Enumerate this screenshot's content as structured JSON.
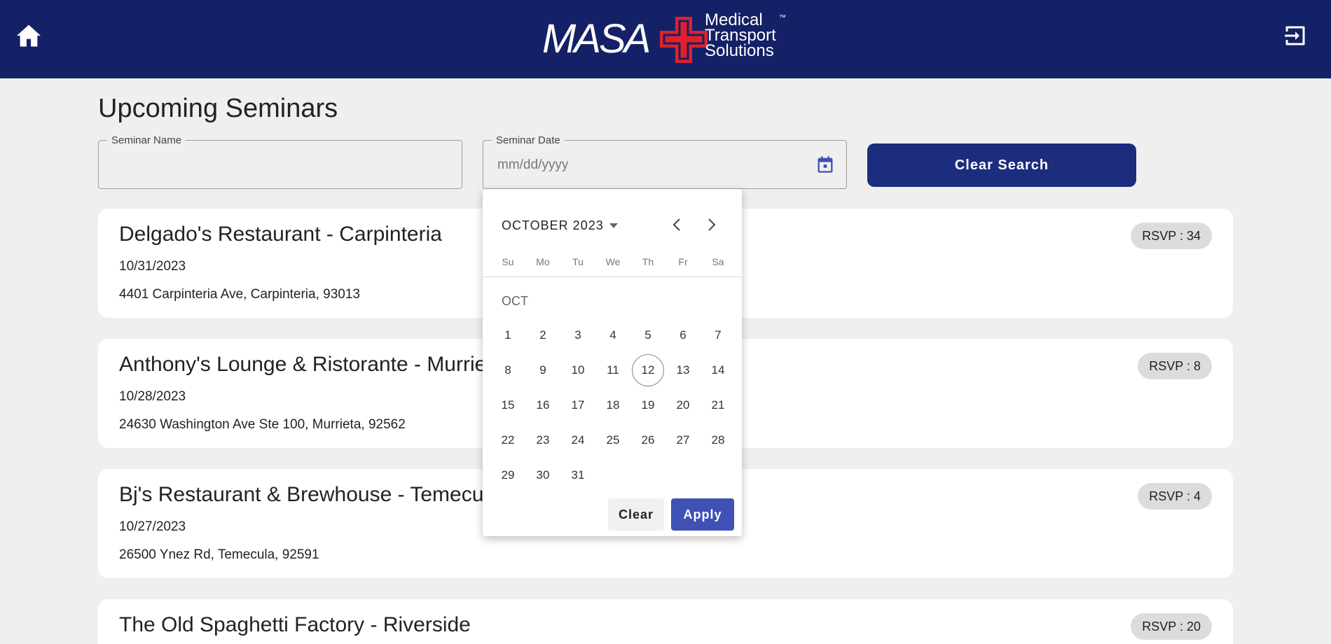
{
  "header": {
    "logo_word": "MASA",
    "logo_tagline": [
      "Medical",
      "Transport",
      "Solutions"
    ],
    "logo_tm": "™",
    "home_icon": "home-icon",
    "logout_icon": "logout-icon",
    "bg_color": "#152166"
  },
  "page": {
    "title": "Upcoming Seminars"
  },
  "search": {
    "name_label": "Seminar Name",
    "name_value": "",
    "date_label": "Seminar Date",
    "date_placeholder": "mm/dd/yyyy",
    "clear_label": "Clear Search"
  },
  "seminars": [
    {
      "name": "Delgado's Restaurant - Carpinteria",
      "date": "10/31/2023",
      "address": "4401 Carpinteria Ave, Carpinteria, 93013",
      "rsvp": "RSVP : 34"
    },
    {
      "name": "Anthony's Lounge & Ristorante - Murrieta",
      "date": "10/28/2023",
      "address": "24630 Washington Ave Ste 100, Murrieta, 92562",
      "rsvp": "RSVP : 8"
    },
    {
      "name": "Bj's Restaurant & Brewhouse - Temecula",
      "date": "10/27/2023",
      "address": "26500 Ynez Rd, Temecula, 92591",
      "rsvp": "RSVP : 4"
    },
    {
      "name": "The Old Spaghetti Factory - Riverside",
      "date": "",
      "address": "",
      "rsvp": "RSVP : 20"
    }
  ],
  "datepicker": {
    "month_label": "OCTOBER 2023",
    "weekdays": [
      "Su",
      "Mo",
      "Tu",
      "We",
      "Th",
      "Fr",
      "Sa"
    ],
    "month_abbr": "OCT",
    "first_weekday": 0,
    "days_in_month": 31,
    "today": 12,
    "clear_label": "Clear",
    "apply_label": "Apply",
    "accent": "#3f51b5"
  }
}
